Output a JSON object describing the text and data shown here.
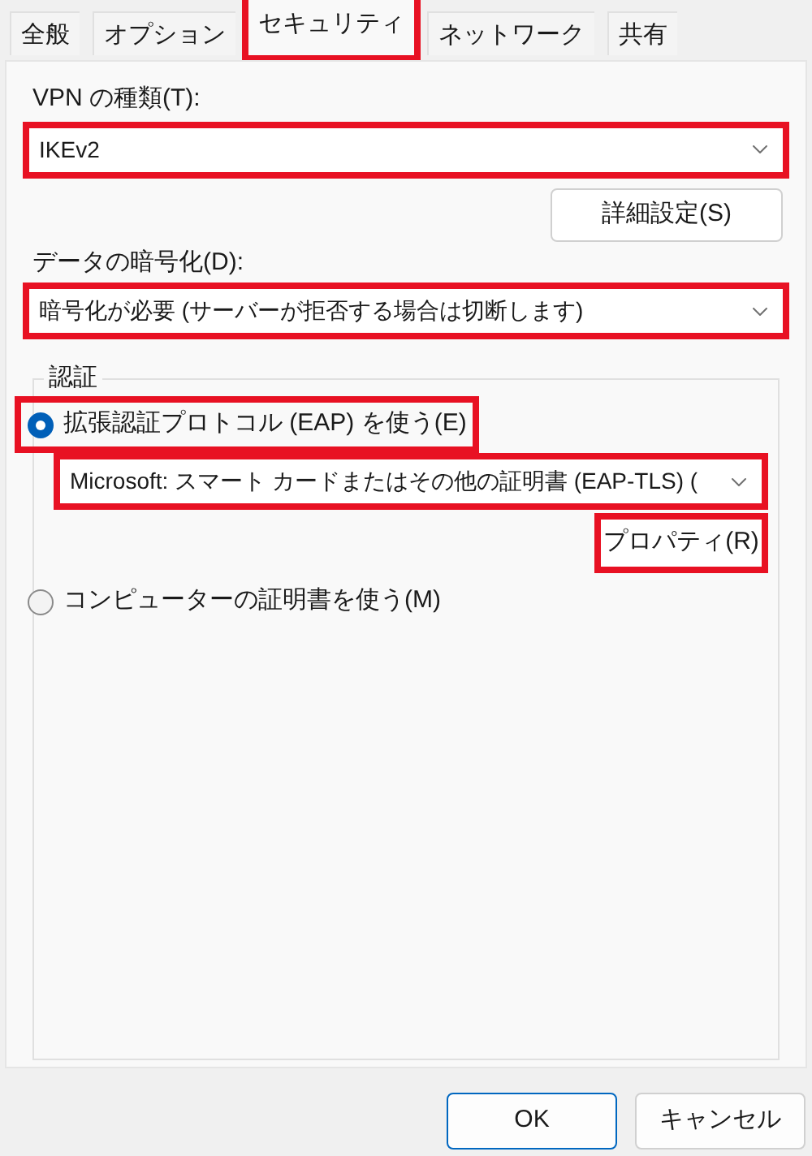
{
  "tabs": [
    {
      "label": "全般",
      "selected": false,
      "highlighted": false
    },
    {
      "label": "オプション",
      "selected": false,
      "highlighted": false
    },
    {
      "label": "セキュリティ",
      "selected": true,
      "highlighted": true
    },
    {
      "label": "ネットワーク",
      "selected": false,
      "highlighted": false
    },
    {
      "label": "共有",
      "selected": false,
      "highlighted": false
    }
  ],
  "vpn_type": {
    "label": "VPN の種類(T):",
    "value": "IKEv2",
    "highlighted": true
  },
  "advanced_button": {
    "label": "詳細設定(S)"
  },
  "encryption": {
    "label": "データの暗号化(D):",
    "value": "暗号化が必要 (サーバーが拒否する場合は切断します)",
    "highlighted": true
  },
  "authentication": {
    "title": "認証",
    "eap": {
      "label": "拡張認証プロトコル (EAP) を使う(E)",
      "selected": true,
      "highlighted": true
    },
    "eap_method": {
      "value": "Microsoft: スマート カードまたはその他の証明書 (EAP-TLS) (",
      "highlighted": true
    },
    "properties_button": {
      "label": "プロパティ(R)",
      "highlighted": true
    },
    "certificate": {
      "label": "コンピューターの証明書を使う(M)",
      "selected": false,
      "highlighted": false
    }
  },
  "buttons": [
    {
      "label": "OK",
      "kind": "default"
    },
    {
      "label": "キャンセル",
      "kind": "normal"
    }
  ]
}
